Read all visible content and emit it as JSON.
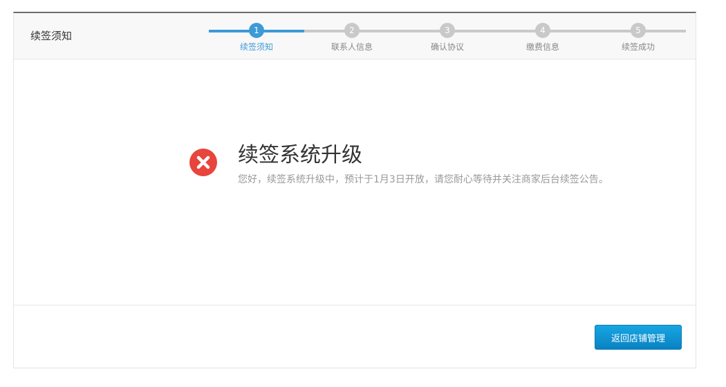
{
  "header": {
    "title": "续签须知"
  },
  "steps": {
    "progress": 0.2,
    "items": [
      {
        "number": "1",
        "label": "续签须知",
        "active": true
      },
      {
        "number": "2",
        "label": "联系人信息",
        "active": false
      },
      {
        "number": "3",
        "label": "确认协议",
        "active": false
      },
      {
        "number": "4",
        "label": "缴费信息",
        "active": false
      },
      {
        "number": "5",
        "label": "续签成功",
        "active": false
      }
    ]
  },
  "message": {
    "icon": "error-circle-icon",
    "title": "续签系统升级",
    "description": "您好，续签系统升级中，预计于1月3日开放，请您耐心等待并关注商家后台续签公告。"
  },
  "footer": {
    "back_label": "返回店铺管理"
  },
  "colors": {
    "accent": "#3d9ad8",
    "error": "#e8453c",
    "button": "#0a82c2"
  }
}
